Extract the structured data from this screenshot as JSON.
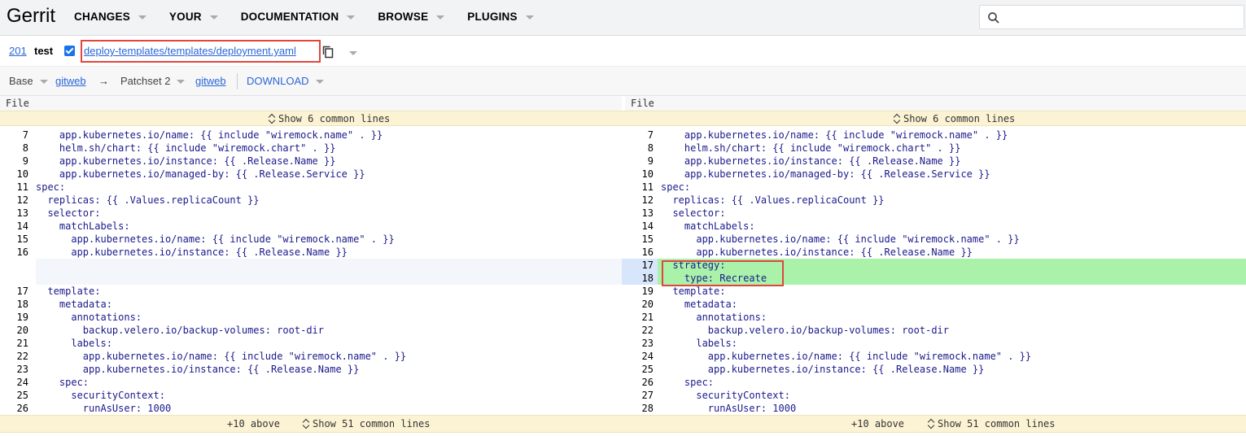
{
  "app": {
    "logo": "Gerrit"
  },
  "nav": [
    {
      "label": "CHANGES"
    },
    {
      "label": "YOUR"
    },
    {
      "label": "DOCUMENTATION"
    },
    {
      "label": "BROWSE"
    },
    {
      "label": "PLUGINS"
    }
  ],
  "search": {
    "placeholder": "",
    "icon": "search-icon"
  },
  "change": {
    "number": "201",
    "subject": "test",
    "file_path": "deploy-templates/templates/deployment.yaml"
  },
  "range": {
    "base": "Base",
    "base_link": "gitweb",
    "arrow": "→",
    "patchset": "Patchset 2",
    "patchset_link": "gitweb",
    "download": "DOWNLOAD"
  },
  "diff": {
    "left_header": "File",
    "right_header": "File",
    "top_context": "Show 6 common lines",
    "bottom_above": "+10 above",
    "bottom_context": "Show 51 common lines",
    "left_lines": [
      {
        "n": "7",
        "t": "    app.kubernetes.io/name: {{ include \"wiremock.name\" . }}"
      },
      {
        "n": "8",
        "t": "    helm.sh/chart: {{ include \"wiremock.chart\" . }}"
      },
      {
        "n": "9",
        "t": "    app.kubernetes.io/instance: {{ .Release.Name }}"
      },
      {
        "n": "10",
        "t": "    app.kubernetes.io/managed-by: {{ .Release.Service }}"
      },
      {
        "n": "11",
        "t": "spec:"
      },
      {
        "n": "12",
        "t": "  replicas: {{ .Values.replicaCount }}"
      },
      {
        "n": "13",
        "t": "  selector:"
      },
      {
        "n": "14",
        "t": "    matchLabels:"
      },
      {
        "n": "15",
        "t": "      app.kubernetes.io/name: {{ include \"wiremock.name\" . }}"
      },
      {
        "n": "16",
        "t": "      app.kubernetes.io/instance: {{ .Release.Name }}"
      },
      {
        "n": "",
        "t": ""
      },
      {
        "n": "",
        "t": ""
      },
      {
        "n": "17",
        "t": "  template:"
      },
      {
        "n": "18",
        "t": "    metadata:"
      },
      {
        "n": "19",
        "t": "      annotations:"
      },
      {
        "n": "20",
        "t": "        backup.velero.io/backup-volumes: root-dir"
      },
      {
        "n": "21",
        "t": "      labels:"
      },
      {
        "n": "22",
        "t": "        app.kubernetes.io/name: {{ include \"wiremock.name\" . }}"
      },
      {
        "n": "23",
        "t": "        app.kubernetes.io/instance: {{ .Release.Name }}"
      },
      {
        "n": "24",
        "t": "    spec:"
      },
      {
        "n": "25",
        "t": "      securityContext:"
      },
      {
        "n": "26",
        "t": "        runAsUser: 1000"
      }
    ],
    "right_lines": [
      {
        "n": "7",
        "t": "    app.kubernetes.io/name: {{ include \"wiremock.name\" . }}"
      },
      {
        "n": "8",
        "t": "    helm.sh/chart: {{ include \"wiremock.chart\" . }}"
      },
      {
        "n": "9",
        "t": "    app.kubernetes.io/instance: {{ .Release.Name }}"
      },
      {
        "n": "10",
        "t": "    app.kubernetes.io/managed-by: {{ .Release.Service }}"
      },
      {
        "n": "11",
        "t": "spec:"
      },
      {
        "n": "12",
        "t": "  replicas: {{ .Values.replicaCount }}"
      },
      {
        "n": "13",
        "t": "  selector:"
      },
      {
        "n": "14",
        "t": "    matchLabels:"
      },
      {
        "n": "15",
        "t": "      app.kubernetes.io/name: {{ include \"wiremock.name\" . }}"
      },
      {
        "n": "16",
        "t": "      app.kubernetes.io/instance: {{ .Release.Name }}"
      },
      {
        "n": "17",
        "t": "  strategy:"
      },
      {
        "n": "18",
        "t": "    type: Recreate"
      },
      {
        "n": "19",
        "t": "  template:"
      },
      {
        "n": "20",
        "t": "    metadata:"
      },
      {
        "n": "21",
        "t": "      annotations:"
      },
      {
        "n": "22",
        "t": "        backup.velero.io/backup-volumes: root-dir"
      },
      {
        "n": "23",
        "t": "      labels:"
      },
      {
        "n": "24",
        "t": "        app.kubernetes.io/name: {{ include \"wiremock.name\" . }}"
      },
      {
        "n": "25",
        "t": "        app.kubernetes.io/instance: {{ .Release.Name }}"
      },
      {
        "n": "26",
        "t": "    spec:"
      },
      {
        "n": "27",
        "t": "      securityContext:"
      },
      {
        "n": "28",
        "t": "        runAsUser: 1000"
      }
    ]
  },
  "colors": {
    "added": "#aaf2aa",
    "context_bar": "#fcf3d4",
    "link": "#2a66d9",
    "highlight_box": "#e0463f"
  }
}
